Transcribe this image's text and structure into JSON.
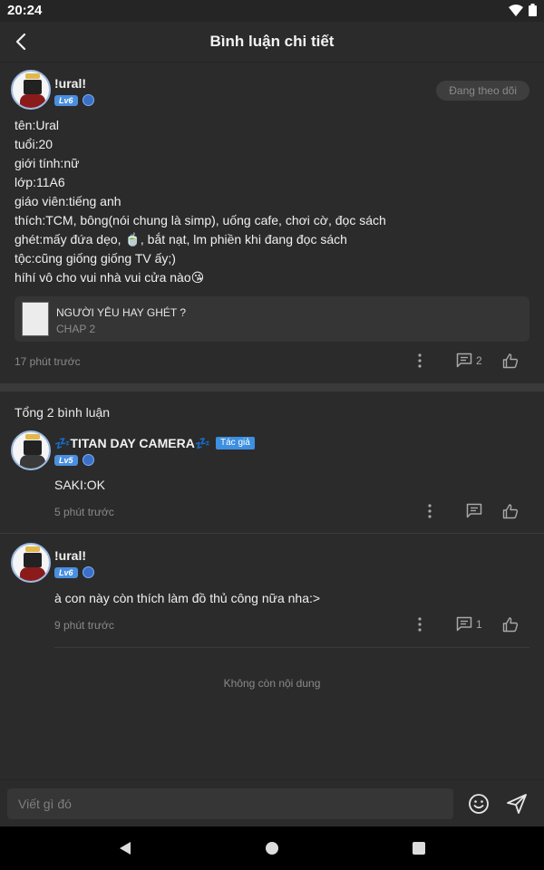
{
  "status_bar": {
    "time": "20:24"
  },
  "header": {
    "title": "Bình luận chi tiết"
  },
  "post": {
    "author": "!ural!",
    "level": "Lv6",
    "follow_label": "Đang theo dõi",
    "lines": [
      "tên:Ural",
      "tuổi:20",
      "giới tính:nữ",
      "lớp:11A6",
      "giáo viên:tiếng anh",
      "thích:TCM, bông(nói chung là simp), uống cafe, chơi cờ, đọc sách",
      "ghét:mấy đứa dẹo, 🍵, bắt nạt, lm phiền khi đang đọc sách",
      "tộc:cũng giống giống TV ấy;)",
      "híhí vô cho vui nhà vui cửa nào😘"
    ],
    "chapter_card": {
      "title": "NGƯỜI YÊU HAY GHÉT ?",
      "subtitle": "CHAP 2"
    },
    "time": "17 phút trước",
    "reply_count": "2"
  },
  "comments_section": {
    "total_label": "Tổng 2 bình luận",
    "comments": [
      {
        "author": "💤TITAN DAY CAMERA💤",
        "author_tag": "Tác giả",
        "level": "Lv5",
        "text": "SAKI:OK",
        "time": "5 phút trước",
        "reply_count": ""
      },
      {
        "author": "!ural!",
        "level": "Lv6",
        "text": "à con này còn thích làm đồ thủ công nữa nha:>",
        "time": "9 phút trước",
        "reply_count": "1"
      }
    ],
    "end_label": "Không còn nội dung"
  },
  "composer": {
    "placeholder": "Viết gì đó"
  },
  "colors": {
    "background": "#2b2b2b",
    "accent": "#4a8fe0",
    "muted_text": "#8a8a8a"
  }
}
